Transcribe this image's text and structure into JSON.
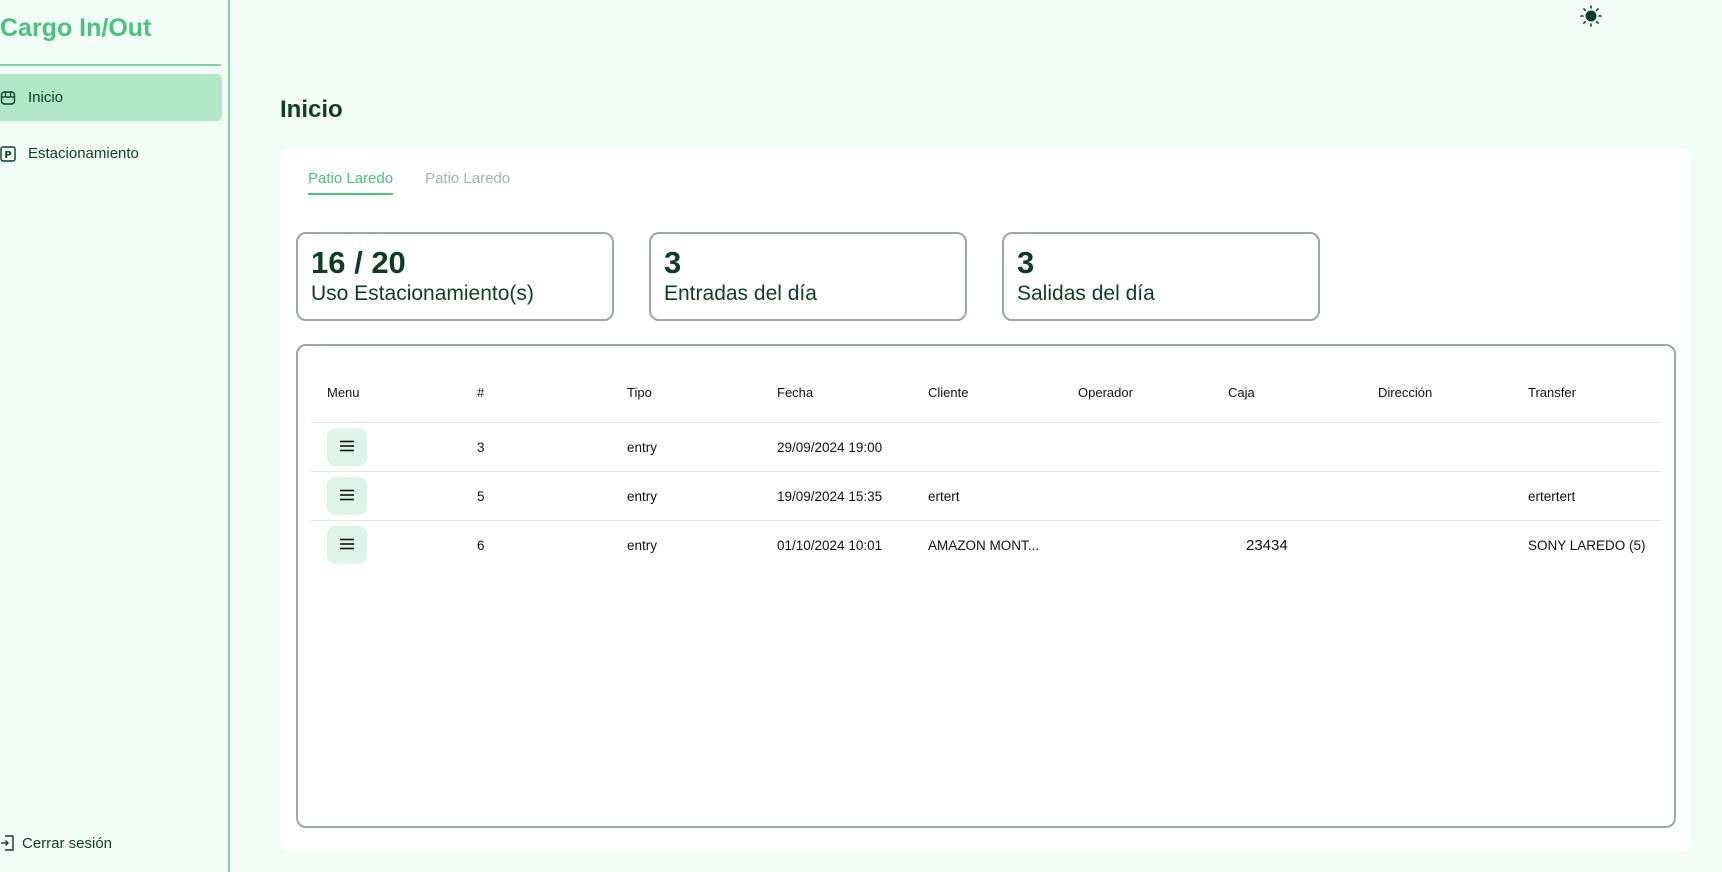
{
  "sidebar": {
    "app_title": "Cargo In/Out",
    "items": [
      {
        "label": "Inicio",
        "icon": "home-icon",
        "active": true
      },
      {
        "label": "Estacionamiento",
        "icon": "parking-icon",
        "active": false
      }
    ],
    "logout_label": "Cerrar sesión"
  },
  "header": {
    "theme_icon": "sun-icon"
  },
  "main": {
    "page_title": "Inicio",
    "tabs": [
      {
        "label": "Patio Laredo",
        "active": true
      },
      {
        "label": "Patio Laredo",
        "active": false
      }
    ],
    "stats": [
      {
        "value": "16 / 20",
        "label": "Uso Estacionamiento(s)"
      },
      {
        "value": "3",
        "label": "Entradas del día"
      },
      {
        "value": "3",
        "label": "Salidas del día"
      }
    ],
    "table": {
      "columns": [
        "Menu",
        "#",
        "Tipo",
        "Fecha",
        "Cliente",
        "Operador",
        "Caja",
        "Dirección",
        "Transfer"
      ],
      "rows": [
        {
          "num": "3",
          "tipo": "entry",
          "fecha": "29/09/2024 19:00",
          "cliente": "",
          "operador": "",
          "caja": "",
          "direccion": "",
          "transfer": ""
        },
        {
          "num": "5",
          "tipo": "entry",
          "fecha": "19/09/2024 15:35",
          "cliente": "ertert",
          "operador": "",
          "caja": "",
          "direccion": "",
          "transfer": "ertertert"
        },
        {
          "num": "6",
          "tipo": "entry",
          "fecha": "01/10/2024 10:01",
          "cliente": "AMAZON MONT...",
          "operador": "",
          "caja": "23434",
          "direccion": "",
          "transfer": "SONY LAREDO (5)"
        }
      ]
    }
  },
  "colors": {
    "accent": "#4cc07d",
    "active_bg": "#b0e8c8",
    "text_dark": "#0f3d24",
    "background": "#f2fdf8"
  }
}
